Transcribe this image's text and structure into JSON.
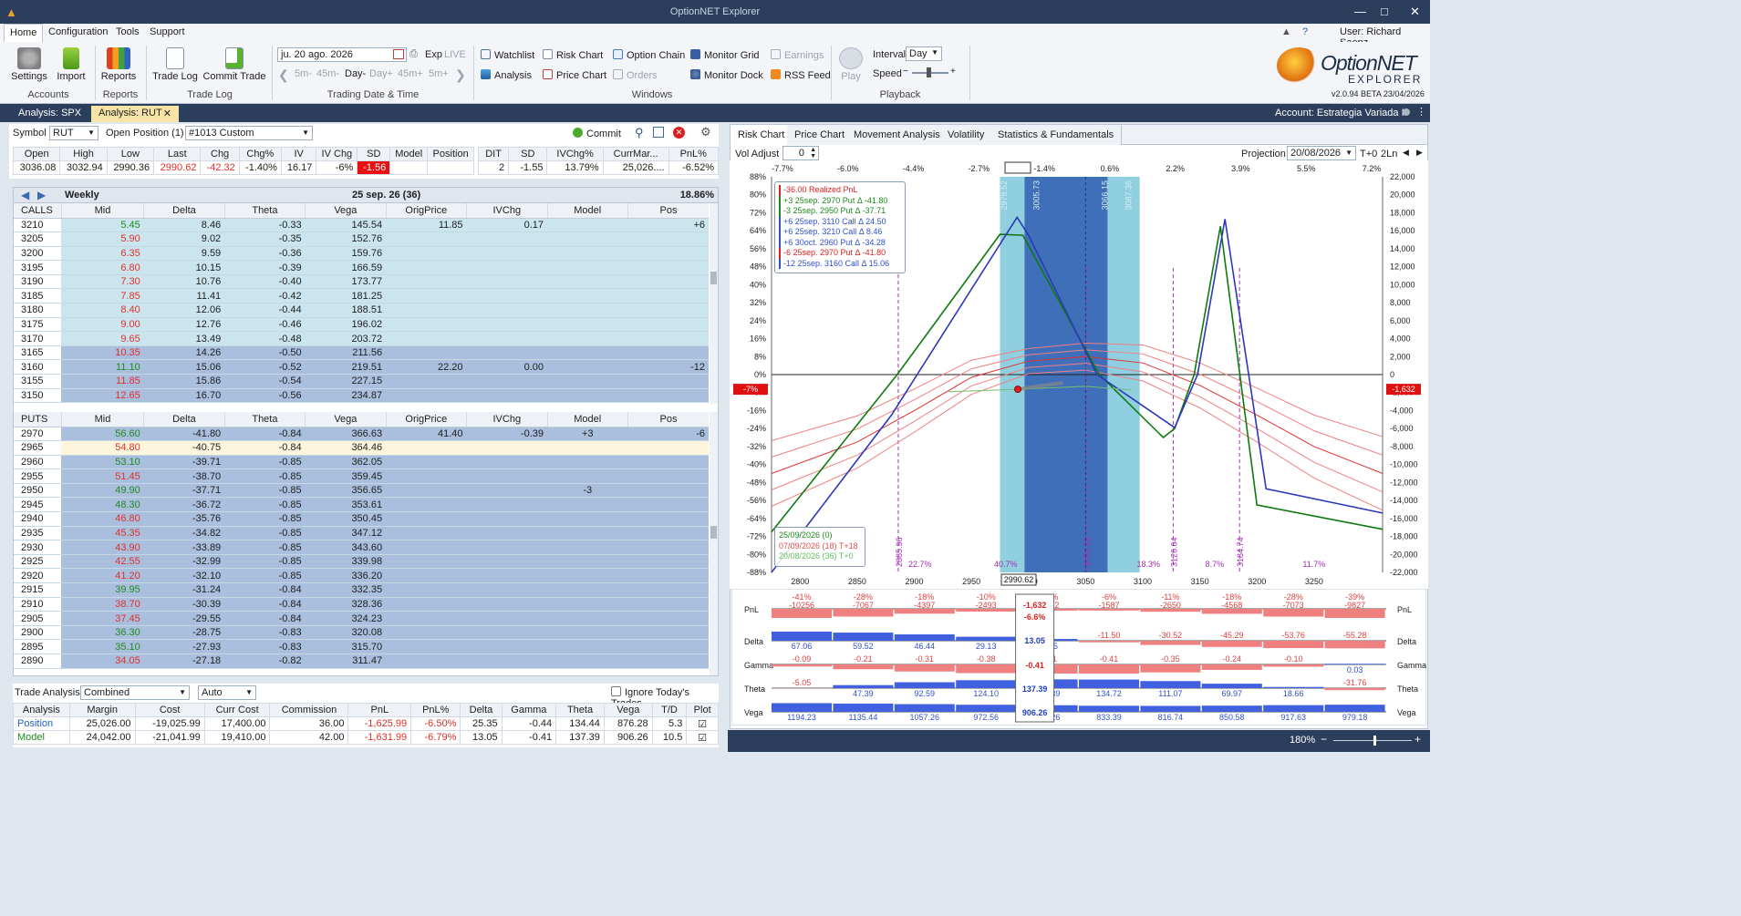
{
  "app": {
    "title": "OptionNET Explorer",
    "user": "User: Richard Saenz",
    "version": "v2.0.94 BETA 23/04/2026",
    "logo_line1": "OptionNET",
    "logo_line2": "EXPLORER"
  },
  "menu": [
    "Home",
    "Configuration",
    "Tools",
    "Support"
  ],
  "ribbon": {
    "settings": "Settings",
    "import": "Import",
    "accounts": "Accounts",
    "reports": "Reports",
    "reports_group": "Reports",
    "trade_log": "Trade Log",
    "commit_trade": "Commit Trade",
    "trade_log_group": "Trade Log",
    "date": "ju. 20 ago. 2026",
    "exp": "Exp",
    "live": "LIVE",
    "steps": [
      "5m-",
      "45m-",
      "Day-",
      "Day+",
      "45m+",
      "5m+"
    ],
    "trading_group": "Trading Date & Time",
    "watchlist": "Watchlist",
    "risk_chart": "Risk Chart",
    "option_chain": "Option Chain",
    "monitor_grid": "Monitor Grid",
    "earnings": "Earnings",
    "analysis": "Analysis",
    "price_chart": "Price Chart",
    "orders": "Orders",
    "monitor_dock": "Monitor Dock",
    "rss_feed": "RSS Feed",
    "windows_group": "Windows",
    "play": "Play",
    "interval_label": "Interval",
    "interval": "Day",
    "speed_label": "Speed",
    "playback_group": "Playback"
  },
  "doc_tabs": [
    "Analysis: SPX",
    "Analysis: RUT"
  ],
  "account": "Account: Estrategia Variada II",
  "symbol": {
    "label": "Symbol",
    "value": "RUT",
    "open_pos_label": "Open Position (1)",
    "open_pos": "#1013 Custom",
    "commit": "Commit"
  },
  "quote": {
    "headers": [
      "Open",
      "High",
      "Low",
      "Last",
      "Chg",
      "Chg%",
      "IV",
      "IV Chg",
      "SD",
      "Model",
      "Position"
    ],
    "values": [
      "3036.08",
      "3032.94",
      "2990.36",
      "2990.62",
      "-42.32",
      "-1.40%",
      "16.17",
      "-6%",
      "-1.56",
      "",
      ""
    ]
  },
  "stats": {
    "headers": [
      "DIT",
      "SD",
      "IVChg%",
      "CurrMar...",
      "PnL%"
    ],
    "values": [
      "2",
      "-1.55",
      "13.79%",
      "25,026....",
      "-6.52%"
    ]
  },
  "expiry": {
    "label": "Weekly",
    "date": "25 sep. 26 (36)",
    "iv": "18.86%"
  },
  "chain_headers": [
    "Mid",
    "Delta",
    "Theta",
    "Vega",
    "OrigPrice",
    "IVChg",
    "Model",
    "Pos"
  ],
  "calls_label": "CALLS",
  "calls": [
    [
      "3210",
      "5.45",
      "8.46",
      "-0.33",
      "145.54",
      "11.85",
      "0.17",
      "",
      "+6",
      "lb",
      "g"
    ],
    [
      "3205",
      "5.90",
      "9.02",
      "-0.35",
      "152.76",
      "",
      "",
      "",
      "",
      "lb",
      "r"
    ],
    [
      "3200",
      "6.35",
      "9.59",
      "-0.36",
      "159.76",
      "",
      "",
      "",
      "",
      "lb",
      "r"
    ],
    [
      "3195",
      "6.80",
      "10.15",
      "-0.39",
      "166.59",
      "",
      "",
      "",
      "",
      "lb",
      "r"
    ],
    [
      "3190",
      "7.30",
      "10.76",
      "-0.40",
      "173.77",
      "",
      "",
      "",
      "",
      "lb",
      "r"
    ],
    [
      "3185",
      "7.85",
      "11.41",
      "-0.42",
      "181.25",
      "",
      "",
      "",
      "",
      "lb",
      "r"
    ],
    [
      "3180",
      "8.40",
      "12.06",
      "-0.44",
      "188.51",
      "",
      "",
      "",
      "",
      "lb",
      "r"
    ],
    [
      "3175",
      "9.00",
      "12.76",
      "-0.46",
      "196.02",
      "",
      "",
      "",
      "",
      "lb",
      "r"
    ],
    [
      "3170",
      "9.65",
      "13.49",
      "-0.48",
      "203.72",
      "",
      "",
      "",
      "",
      "lb",
      "r"
    ],
    [
      "3165",
      "10.35",
      "14.26",
      "-0.50",
      "211.56",
      "",
      "",
      "",
      "",
      "db",
      "r"
    ],
    [
      "3160",
      "11.10",
      "15.06",
      "-0.52",
      "219.51",
      "22.20",
      "0.00",
      "",
      "-12",
      "db",
      "g"
    ],
    [
      "3155",
      "11.85",
      "15.86",
      "-0.54",
      "227.15",
      "",
      "",
      "",
      "",
      "db",
      "r"
    ],
    [
      "3150",
      "12.65",
      "16.70",
      "-0.56",
      "234.87",
      "",
      "",
      "",
      "",
      "db",
      "r"
    ]
  ],
  "puts_label": "PUTS",
  "puts": [
    [
      "2970",
      "56.60",
      "-41.80",
      "-0.84",
      "366.63",
      "41.40",
      "-0.39",
      "+3",
      "-6",
      "db",
      "g"
    ],
    [
      "2965",
      "54.80",
      "-40.75",
      "-0.84",
      "364.46",
      "",
      "",
      "",
      "",
      "yl",
      "r"
    ],
    [
      "2960",
      "53.10",
      "-39.71",
      "-0.85",
      "362.05",
      "",
      "",
      "",
      "",
      "db",
      "g"
    ],
    [
      "2955",
      "51.45",
      "-38.70",
      "-0.85",
      "359.45",
      "",
      "",
      "",
      "",
      "db",
      "r"
    ],
    [
      "2950",
      "49.90",
      "-37.71",
      "-0.85",
      "356.65",
      "",
      "",
      "-3",
      "",
      "db",
      "g"
    ],
    [
      "2945",
      "48.30",
      "-36.72",
      "-0.85",
      "353.61",
      "",
      "",
      "",
      "",
      "db",
      "g"
    ],
    [
      "2940",
      "46.80",
      "-35.76",
      "-0.85",
      "350.45",
      "",
      "",
      "",
      "",
      "db",
      "r"
    ],
    [
      "2935",
      "45.35",
      "-34.82",
      "-0.85",
      "347.12",
      "",
      "",
      "",
      "",
      "db",
      "r"
    ],
    [
      "2930",
      "43.90",
      "-33.89",
      "-0.85",
      "343.60",
      "",
      "",
      "",
      "",
      "db",
      "r"
    ],
    [
      "2925",
      "42.55",
      "-32.99",
      "-0.85",
      "339.98",
      "",
      "",
      "",
      "",
      "db",
      "r"
    ],
    [
      "2920",
      "41.20",
      "-32.10",
      "-0.85",
      "336.20",
      "",
      "",
      "",
      "",
      "db",
      "r"
    ],
    [
      "2915",
      "39.95",
      "-31.24",
      "-0.84",
      "332.35",
      "",
      "",
      "",
      "",
      "db",
      "g"
    ],
    [
      "2910",
      "38.70",
      "-30.39",
      "-0.84",
      "328.36",
      "",
      "",
      "",
      "",
      "db",
      "r"
    ],
    [
      "2905",
      "37.45",
      "-29.55",
      "-0.84",
      "324.23",
      "",
      "",
      "",
      "",
      "db",
      "r"
    ],
    [
      "2900",
      "36.30",
      "-28.75",
      "-0.83",
      "320.08",
      "",
      "",
      "",
      "",
      "db",
      "g"
    ],
    [
      "2895",
      "35.10",
      "-27.93",
      "-0.83",
      "315.70",
      "",
      "",
      "",
      "",
      "db",
      "g"
    ],
    [
      "2890",
      "34.05",
      "-27.18",
      "-0.82",
      "311.47",
      "",
      "",
      "",
      "",
      "db",
      "r"
    ]
  ],
  "trade_analysis": {
    "label": "Trade Analysis",
    "mode": "Combined",
    "auto": "Auto",
    "ignore": "Ignore Today's Trades",
    "headers": [
      "Analysis",
      "Margin",
      "Cost",
      "Curr Cost",
      "Commission",
      "PnL",
      "PnL%",
      "Delta",
      "Gamma",
      "Theta",
      "Vega",
      "T/D",
      "Plot"
    ],
    "rows": [
      [
        "Position",
        "25,026.00",
        "-19,025.99",
        "17,400.00",
        "36.00",
        "-1,625.99",
        "-6.50%",
        "25.35",
        "-0.44",
        "134.44",
        "876.28",
        "5.3"
      ],
      [
        "Model",
        "24,042.00",
        "-21,041.99",
        "19,410.00",
        "42.00",
        "-1,631.99",
        "-6.79%",
        "13.05",
        "-0.41",
        "137.39",
        "906.26",
        "10.5"
      ]
    ]
  },
  "chart_tabs": [
    "Risk Chart",
    "Price Chart",
    "Movement Analysis",
    "Volatility",
    "Statistics & Fundamentals"
  ],
  "vol_adjust": {
    "label": "Vol Adjust",
    "value": "0"
  },
  "projection": {
    "label": "Projection",
    "date": "20/08/2026",
    "t0": "T+0",
    "ln": "2Ln"
  },
  "chart_data": {
    "type": "line",
    "xlim": [
      2775,
      3310
    ],
    "x_ticks": [
      "2800",
      "2850",
      "2900",
      "2950",
      "3000",
      "3050",
      "3100",
      "3150",
      "3200",
      "3250"
    ],
    "x_tick_values": [
      2800,
      2850,
      2900,
      2950,
      3000,
      3050,
      3100,
      3150,
      3200,
      3250
    ],
    "top_pct": [
      "-7.7%",
      "-6.0%",
      "-4.4%",
      "-2.7%",
      "-1.4%",
      "0.6%",
      "2.2%",
      "3.9%",
      "5.5%",
      "7.2%"
    ],
    "left_ticks": [
      "88%",
      "80%",
      "72%",
      "64%",
      "56%",
      "48%",
      "40%",
      "32%",
      "24%",
      "16%",
      "8%",
      "0%",
      "-8%",
      "-16%",
      "-24%",
      "-32%",
      "-40%",
      "-48%",
      "-56%",
      "-64%",
      "-72%",
      "-80%",
      "-88%"
    ],
    "right_ticks": [
      "22,000",
      "20,000",
      "18,000",
      "16,000",
      "14,000",
      "12,000",
      "10,000",
      "8,000",
      "6,000",
      "4,000",
      "2,000",
      "0",
      "-2,000",
      "-4,000",
      "-6,000",
      "-8,000",
      "-10,000",
      "-12,000",
      "-14,000",
      "-16,000",
      "-18,000",
      "-20,000",
      "-22,000"
    ],
    "ylim": [
      -22000,
      22000
    ],
    "current_price": "2990.62",
    "current_pnl_pct": "-7%",
    "current_pnl": "-1,632",
    "sd_labels": [
      "2978.52",
      "3005.73",
      "3066.15",
      "3087.36"
    ],
    "vlines": [
      "2885.96",
      "3050.29",
      "3126.64",
      "3184.74"
    ],
    "vline_values": [
      2885.96,
      3050.29,
      3126.64,
      3184.74
    ],
    "bottom_pcts": [
      "22.7%",
      "40.7%",
      "18.3%",
      "8.7%",
      "11.7%"
    ],
    "legend": [
      {
        "c": "#e02020",
        "t": "-36.00 Realized PnL"
      },
      {
        "c": "#1f8a1f",
        "t": "+3 25sep. 2970 Put Δ  -41.80"
      },
      {
        "c": "#1f8a1f",
        "t": "-3 25sep. 2950 Put Δ  -37.71"
      },
      {
        "c": "#3050d0",
        "t": "+6 25sep. 3110 Call Δ  24.50"
      },
      {
        "c": "#3050d0",
        "t": "+6 25sep. 3210 Call Δ   8.46"
      },
      {
        "c": "#3050d0",
        "t": "+6 30oct. 2960 Put Δ  -34.28"
      },
      {
        "c": "#e02020",
        "t": "-6 25sep. 2970 Put Δ  -41.80"
      },
      {
        "c": "#3050d0",
        "t": "-12 25sep. 3160 Call Δ  15.06"
      }
    ],
    "date_legend": [
      {
        "c": "#1f8a1f",
        "t": "25/09/2026 (0)"
      },
      {
        "c": "#e05050",
        "t": "07/09/2026 (18) T+18"
      },
      {
        "c": "#60c060",
        "t": "20/08/2026 (36) T+0"
      }
    ],
    "series": [
      {
        "name": "25/09/2026 (0)",
        "color": "#0f7a0f",
        "x": [
          2775,
          2885,
          2975,
          2995,
          3062,
          3118,
          3128,
          3145,
          3168,
          3200,
          3310
        ],
        "y": [
          -17500,
          0,
          15600,
          15500,
          0,
          -7000,
          -6000,
          0,
          16500,
          -14500,
          -17200
        ]
      },
      {
        "name": "T+0",
        "color": "#2c38b8",
        "x": [
          2775,
          2880,
          2990,
          3000,
          3060,
          3128,
          3148,
          3172,
          3208,
          3310
        ],
        "y": [
          -22000,
          -4500,
          17500,
          15500,
          0,
          -5900,
          0,
          17300,
          -12700,
          -15400
        ]
      },
      {
        "name": "07/09/2026 (18) T+18",
        "color": "#e03030",
        "x": [
          2775,
          2850,
          2900,
          2950,
          3000,
          3050,
          3100,
          3150,
          3200,
          3250,
          3310
        ],
        "y": [
          -11000,
          -7500,
          -4000,
          -300,
          1500,
          2000,
          1300,
          -1200,
          -4500,
          -8000,
          -11000
        ]
      }
    ]
  },
  "greeks": {
    "rows": [
      "PnL",
      "Delta",
      "Gamma",
      "Theta",
      "Vega"
    ],
    "pnl_pct": [
      "-41%",
      "-28%",
      "-18%",
      "-10%",
      "-6.6%",
      "-6%",
      "-11%",
      "-18%",
      "-28%",
      "-39%"
    ],
    "pnl": [
      "-10256",
      "-7067",
      "-4397",
      "-2493",
      "-1,632",
      "-1587",
      "-2650",
      "-4568",
      "-7073",
      "-9827"
    ],
    "delta": [
      "67.06",
      "59.52",
      "46.44",
      "29.13",
      "13.05",
      "-11.50",
      "-30.52",
      "-45.29",
      "-53.76",
      "-55.28"
    ],
    "gamma": [
      "-0.09",
      "-0.21",
      "-0.31",
      "-0.38",
      "-0.41",
      "-0.41",
      "-0.35",
      "-0.24",
      "-0.10",
      "0.03"
    ],
    "theta": [
      "-5.05",
      "47.39",
      "92.59",
      "124.10",
      "137.39",
      "134.72",
      "111.07",
      "69.97",
      "18.66",
      "-31.76"
    ],
    "vega": [
      "1194.23",
      "1135.44",
      "1057.26",
      "972.56",
      "906.26",
      "833.39",
      "816.74",
      "850.58",
      "917.63",
      "979.18"
    ]
  },
  "zoom": "180%"
}
